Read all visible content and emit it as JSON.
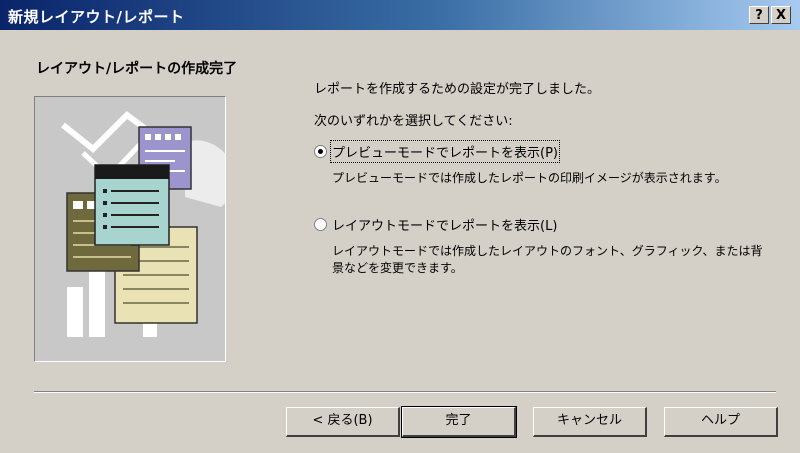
{
  "window": {
    "title": "新規レイアウト/レポート",
    "help_btn": "?",
    "close_btn": "X"
  },
  "header": {
    "title": "レイアウト/レポートの作成完了"
  },
  "content": {
    "intro": "レポートを作成するための設定が完了しました。",
    "prompt": "次のいずれかを選択してください:",
    "options": [
      {
        "label": "プレビューモードでレポートを表示(P)",
        "selected": true,
        "description": "プレビューモードでは作成したレポートの印刷イメージが表示されます。"
      },
      {
        "label": "レイアウトモードでレポートを表示(L)",
        "selected": false,
        "description": "レイアウトモードでは作成したレイアウトのフォント、グラフィック、または背景などを変更できます。"
      }
    ]
  },
  "buttons": {
    "back": "< 戻る(B)",
    "finish": "完了",
    "cancel": "キャンセル",
    "help": "ヘルプ"
  }
}
